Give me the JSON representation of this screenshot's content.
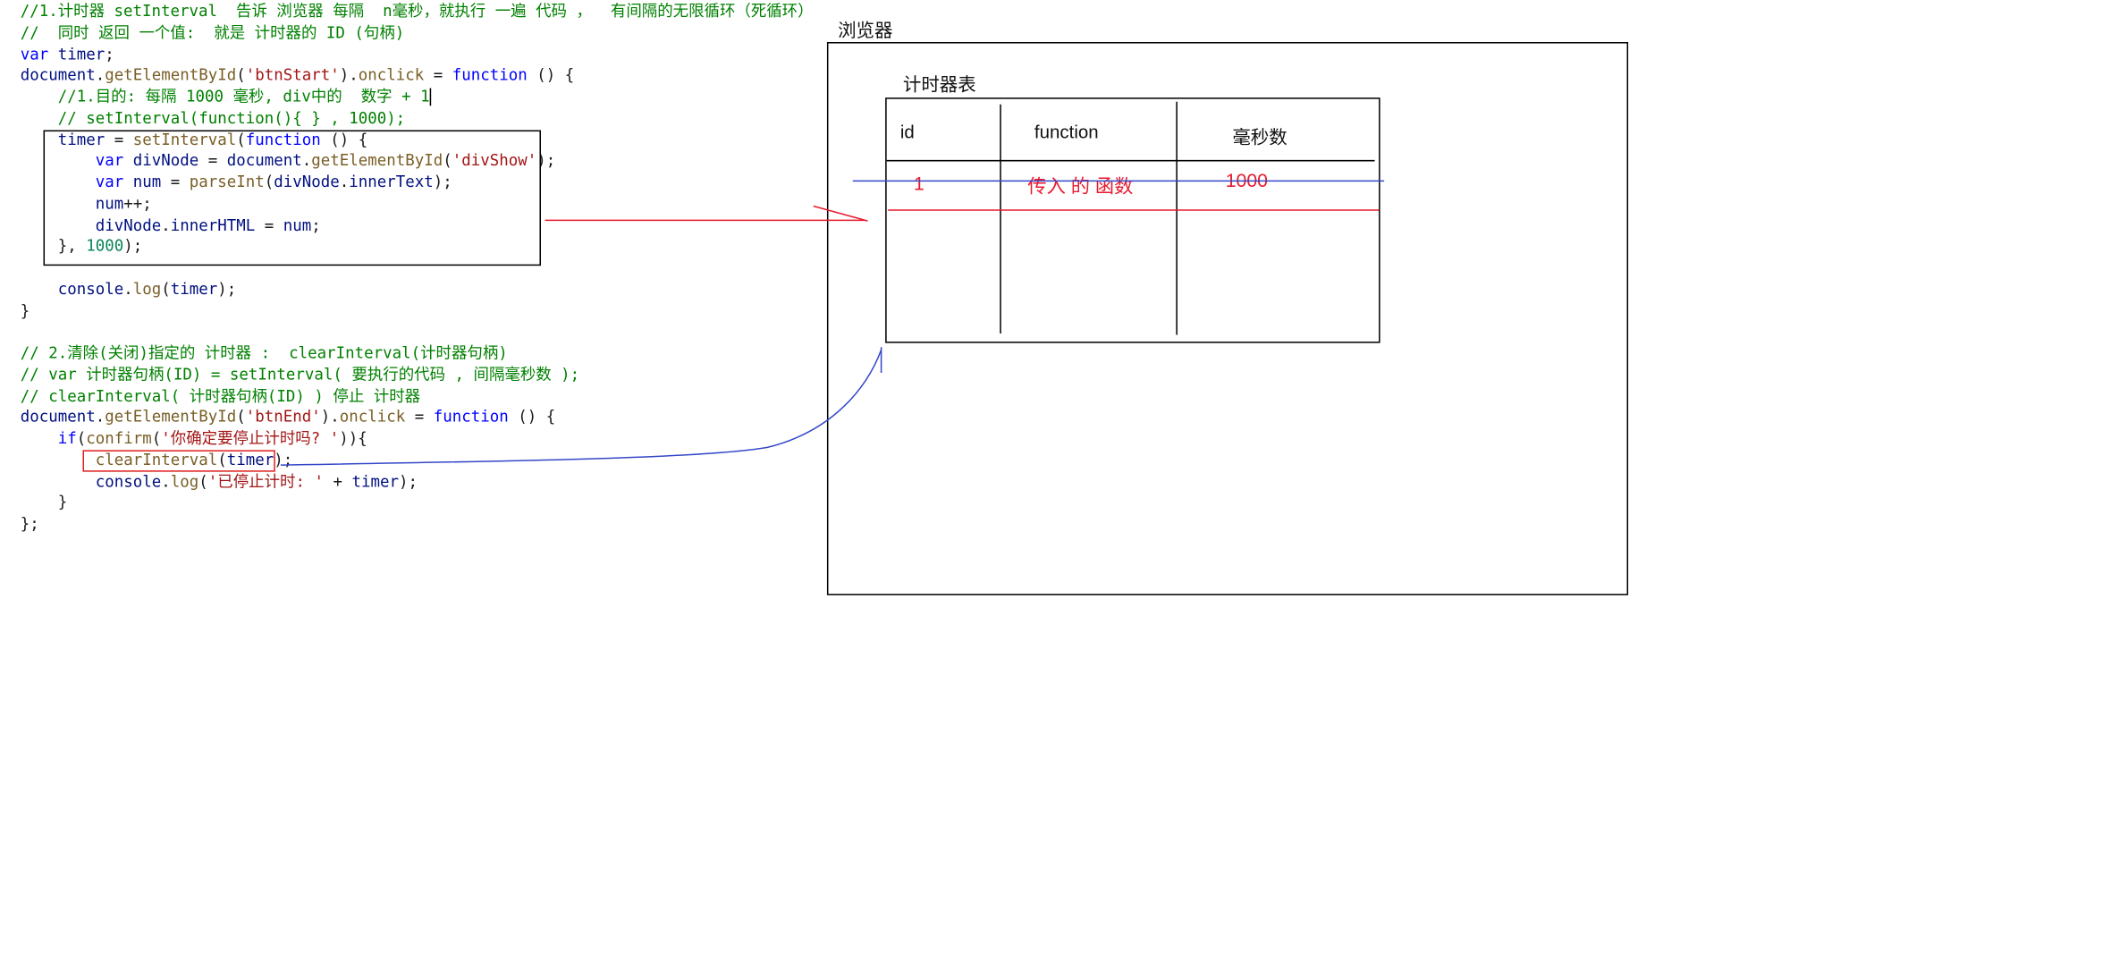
{
  "code": {
    "line1": "//1.计时器 setInterval  告诉 浏览器 每隔  n毫秒，就执行 一遍 代码 ，  有间隔的无限循环（死循环）",
    "line2": "//  同时 返回 一个值:  就是 计时器的 ID (句柄)",
    "l3_var": "var",
    "l3_timer": "timer",
    "l4_document": "document",
    "l4_getById": "getElementById",
    "l4_arg": "'btnStart'",
    "l4_onclick": "onclick",
    "l4_function": "function",
    "l5_comment": "//1.目的: 每隔 1000 毫秒, div中的  数字 + 1",
    "l6_comment": "// setInterval(function(){ } , 1000);",
    "l7_timer": "timer",
    "l7_setInterval": "setInterval",
    "l7_function": "function",
    "l8_var": "var",
    "l8_divNode": "divNode",
    "l8_document": "document",
    "l8_getById": "getElementById",
    "l8_arg": "'divShow'",
    "l9_var": "var",
    "l9_num": "num",
    "l9_parseInt": "parseInt",
    "l9_divNode": "divNode",
    "l9_innerText": "innerText",
    "l10_num": "num",
    "l11_divNode": "divNode",
    "l11_innerHTML": "innerHTML",
    "l11_num": "num",
    "l12_interval": "1000",
    "l14_console": "console",
    "l14_log": "log",
    "l14_timer": "timer",
    "l17_comment": "// 2.清除(关闭)指定的 计时器 :  clearInterval(计时器句柄)",
    "l18_comment": "// var 计时器句柄(ID) = setInterval( 要执行的代码 , 间隔毫秒数 );",
    "l19_comment": "// clearInterval( 计时器句柄(ID) ) 停止 计时器",
    "l20_document": "document",
    "l20_getById": "getElementById",
    "l20_arg": "'btnEnd'",
    "l20_onclick": "onclick",
    "l20_function": "function",
    "l21_if": "if",
    "l21_confirm": "confirm",
    "l21_arg": "'你确定要停止计时吗? '",
    "l22_clearInterval": "clearInterval",
    "l22_timer": "timer",
    "l23_console": "console",
    "l23_log": "log",
    "l23_arg": "'已停止计时: '",
    "l23_timer": "timer"
  },
  "diagram": {
    "browser_label": "浏览器",
    "table_title": "计时器表",
    "headers": [
      "id",
      "function",
      "毫秒数"
    ],
    "row": {
      "id": "1",
      "function": "传入 的 函数",
      "ms": "1000"
    }
  },
  "colors": {
    "annotation_red": "#e8192c",
    "annotation_blue": "#3347c8"
  }
}
